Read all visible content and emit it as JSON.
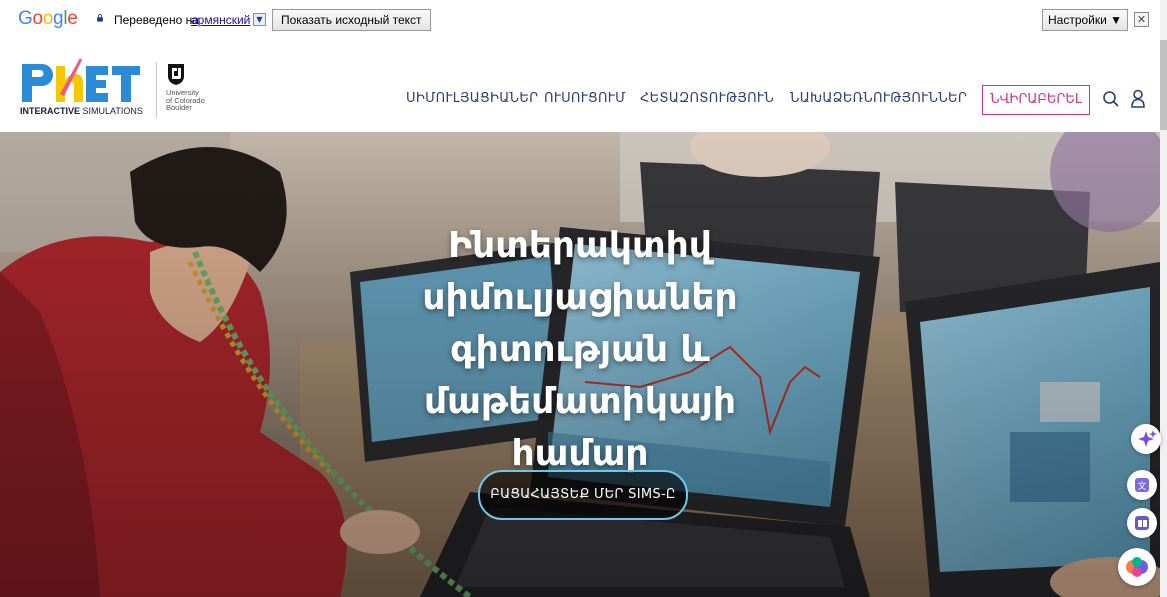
{
  "translate_bar": {
    "google_logo": "Google",
    "translated_to_label": "Переведено на",
    "language": "армянский",
    "show_original_button": "Показать исходный текст",
    "settings_button": "Настройки ▼",
    "close_icon": "close-icon"
  },
  "header": {
    "logo_text": "PhET",
    "logo_subtitle_bold": "INTERACTIVE",
    "logo_subtitle_rest": "SIMULATIONS",
    "university": {
      "line1": "University",
      "line2": "of Colorado",
      "line3": "Boulder"
    },
    "nav": [
      {
        "label": "ՍԻՄՈՒԼՅԱՑԻԱՆԵՐ"
      },
      {
        "label": "ՈՒՍՈՒՑՈՒՄ"
      },
      {
        "label": "ՀԵՏԱԶՈՏՈՒԹՅՈՒՆ"
      },
      {
        "label": "ՆԱԽԱՁԵՌՆՈՒԹՅՈՒՆՆԵՐ"
      }
    ],
    "donate_label": "ՆՎԻՐԱԲԵՐԵԼ",
    "search_icon": "search-icon",
    "user_icon": "user-icon"
  },
  "hero": {
    "title_lines": [
      "Ինտերակտիվ",
      "սիմուլյացիաներ",
      "գիտության և",
      "մաթեմատիկայի",
      "համար"
    ],
    "cta_label": "ԲԱՑԱՀԱՅՏԵՔ ՄԵՐ SIMS-Ը"
  },
  "side_buttons": [
    "sparkle-icon",
    "translate-icon",
    "reader-icon",
    "brain-icon"
  ],
  "colors": {
    "nav_text": "#2c3e72",
    "donate": "#d63384",
    "cta_border": "#6ec6ea",
    "phet_blue": "#2b8bd6",
    "phet_yellow": "#f6c700"
  }
}
